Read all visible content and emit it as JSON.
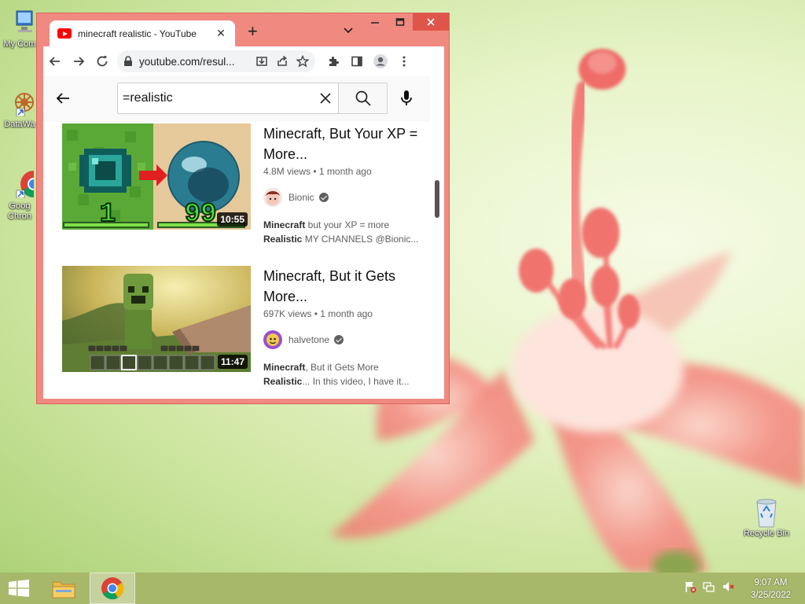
{
  "desktop": {
    "icons": [
      {
        "label": "My Com"
      },
      {
        "label": "DataWa"
      },
      {
        "label": "Goog",
        "label2": "Chron"
      },
      {
        "label": "Recycle Bin"
      }
    ]
  },
  "browser": {
    "tab_title": "minecraft realistic - YouTube",
    "url": "youtube.com/resul...",
    "accent": "#f08a80"
  },
  "youtube": {
    "search_query": "=realistic",
    "results": [
      {
        "title": "Minecraft, But Your XP = More...",
        "views": "4.8M views",
        "age": "1 month ago",
        "channel": "Bionic",
        "duration": "10:55",
        "snippet_bold1": "Minecraft",
        "snippet_text1": " but your XP = more",
        "snippet_bold2": "Realistic",
        "snippet_text2": " MY CHANNELS @Bionic...",
        "thumb_left_num": "1",
        "thumb_right_num": "99"
      },
      {
        "title": "Minecraft, But it Gets More...",
        "views": "697K views",
        "age": "1 month ago",
        "channel": "halvetone",
        "duration": "11:47",
        "snippet_bold1": "Minecraft",
        "snippet_text1": ", But it Gets More",
        "snippet_bold2": "Realistic",
        "snippet_text2": "... In this video, I have it..."
      }
    ]
  },
  "taskbar": {
    "time": "9:07 AM",
    "date": "3/25/2022"
  }
}
